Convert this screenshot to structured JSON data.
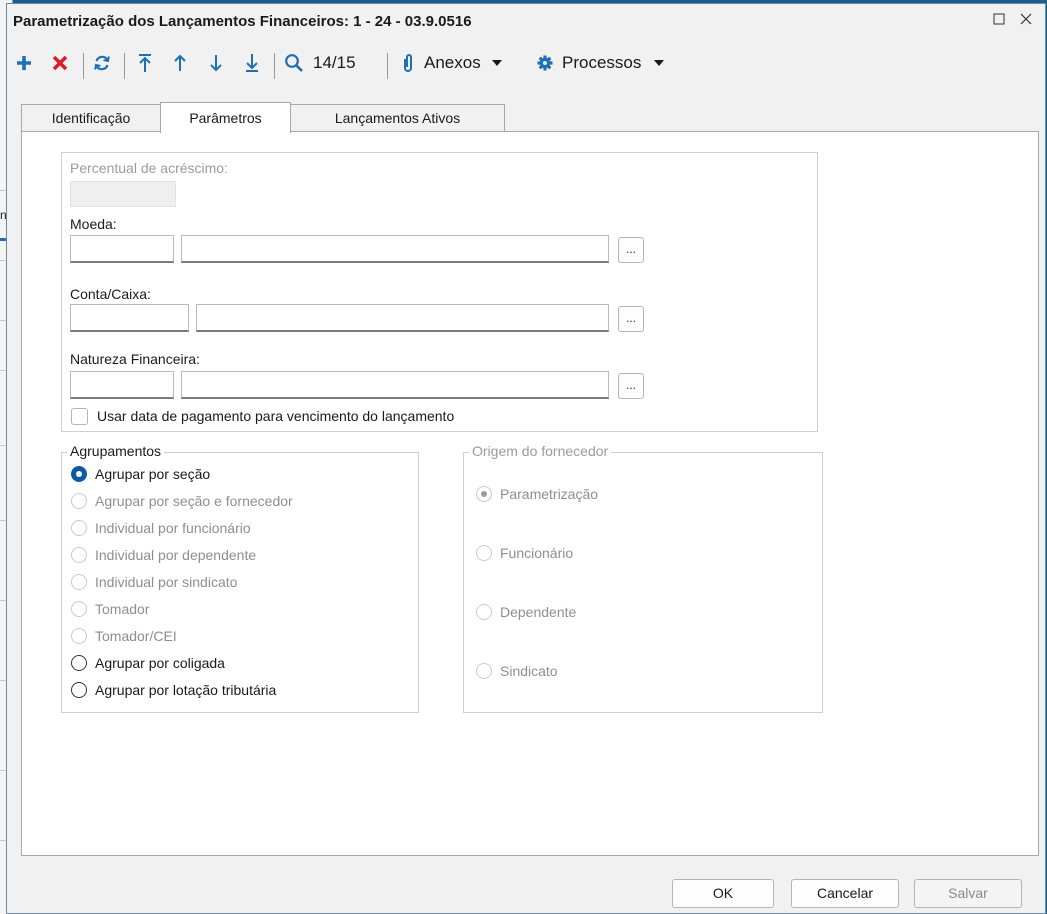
{
  "window": {
    "title": "Parametrização dos Lançamentos Financeiros: 1 - 24 - 03.9.0516"
  },
  "toolbar": {
    "record_position": "14/15",
    "attachments_label": "Anexos",
    "processes_label": "Processos"
  },
  "tabs": [
    {
      "label": "Identificação"
    },
    {
      "label": "Parâmetros"
    },
    {
      "label": "Lançamentos Ativos"
    }
  ],
  "params": {
    "percent_label": "Percentual de acréscimo:",
    "percent_value": "",
    "moeda_label": "Moeda:",
    "moeda_code": "",
    "moeda_desc": "",
    "conta_label": "Conta/Caixa:",
    "conta_code": "",
    "conta_desc": "",
    "natureza_label": "Natureza Financeira:",
    "natureza_code": "",
    "natureza_desc": "",
    "lookup_label": "...",
    "usar_data_label": "Usar data de pagamento para vencimento do lançamento"
  },
  "agrupamentos": {
    "legend": "Agrupamentos",
    "options": [
      {
        "label": "Agrupar por seção",
        "state": "checked"
      },
      {
        "label": "Agrupar por seção e fornecedor",
        "state": "disabled"
      },
      {
        "label": "Individual por funcionário",
        "state": "disabled"
      },
      {
        "label": "Individual por dependente",
        "state": "disabled"
      },
      {
        "label": "Individual por sindicato",
        "state": "disabled"
      },
      {
        "label": "Tomador",
        "state": "disabled"
      },
      {
        "label": "Tomador/CEI",
        "state": "disabled"
      },
      {
        "label": "Agrupar por coligada",
        "state": "enabled"
      },
      {
        "label": "Agrupar por lotação tributária",
        "state": "enabled"
      }
    ]
  },
  "origem": {
    "legend": "Origem do fornecedor",
    "options": [
      {
        "label": "Parametrização",
        "state": "checked-disabled"
      },
      {
        "label": "Funcionário",
        "state": "disabled"
      },
      {
        "label": "Dependente",
        "state": "disabled"
      },
      {
        "label": "Sindicato",
        "state": "disabled"
      }
    ]
  },
  "buttons": {
    "ok": "OK",
    "cancel": "Cancelar",
    "save": "Salvar"
  },
  "colors": {
    "accent": "#0a5aa8",
    "add": "#1f6fb5",
    "delete": "#d9202a",
    "desktop": "#1c5f8f"
  }
}
